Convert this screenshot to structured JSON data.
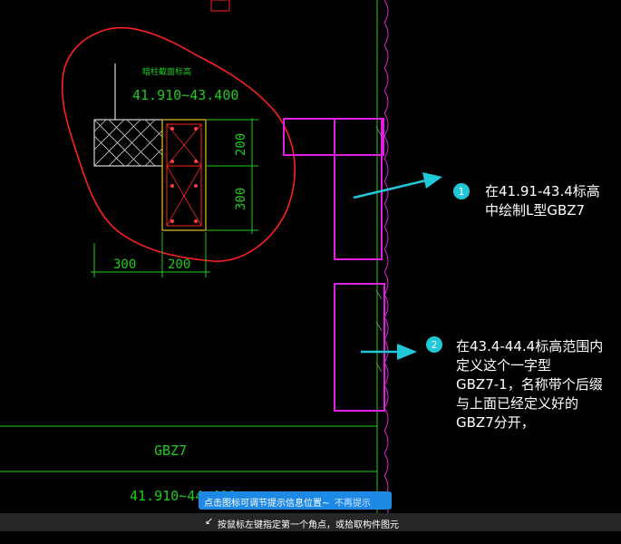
{
  "drawing": {
    "detail_title": "暗柱截面标高",
    "detail_elevation": "41.910~43.400",
    "dim_200_v": "200",
    "dim_300_v": "300",
    "dim_300_h": "300",
    "dim_200_h": "200",
    "column_name": "GBZ7",
    "column_elevation": "41.910~44.400",
    "colors": {
      "cad_green": "#1ecb1e",
      "revision_red": "#ff2020",
      "selection_magenta": "#e020e0",
      "arrow_cyan": "#20c8d8"
    }
  },
  "annotations": [
    {
      "number": "1",
      "lines": [
        "在41.91-43.4标高",
        "中绘制L型GBZ7"
      ]
    },
    {
      "number": "2",
      "lines": [
        "在43.4-44.4标高范围内",
        "定义这个一字型",
        "GBZ7-1，名称带个后缀",
        "与上面已经定义好的",
        "GBZ7分开，"
      ]
    }
  ],
  "tooltip": {
    "message": "点击图标可调节提示信息位置~",
    "dismiss": "不再提示"
  },
  "status_bar": {
    "icon": "cursor-pick-icon",
    "prompt": "按鼠标左键指定第一个角点，或拾取构件图元"
  }
}
